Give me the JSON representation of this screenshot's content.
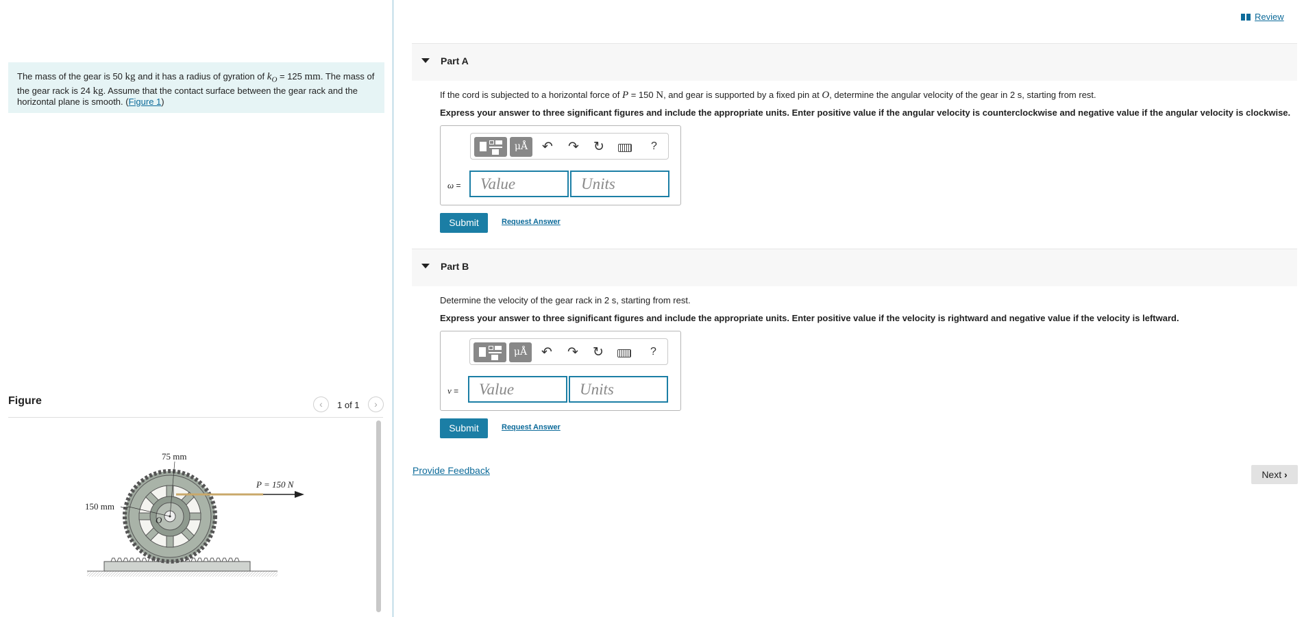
{
  "review": {
    "label": "Review"
  },
  "problem": {
    "t1": "The mass of the gear is 50 ",
    "kg1": "kg",
    "t2": " and it has a radius of gyration of ",
    "kO": "k",
    "kO_sub": "O",
    "t3": " = 125 ",
    "mm": "mm",
    "t4": ". The mass of the gear rack is 24 ",
    "kg2": "kg",
    "t5": ". Assume that the contact surface between the gear rack and the horizontal plane is smooth. (",
    "figure_link": "Figure 1",
    "t6": ")"
  },
  "figure": {
    "title": "Figure",
    "pager": "1 of 1",
    "labels": {
      "top": "75 mm",
      "left": "150 mm",
      "force": "P = 150 N",
      "center": "O"
    }
  },
  "partA": {
    "title": "Part A",
    "q_t1": "If the cord is subjected to a horizontal force of ",
    "q_P": "P",
    "q_t2": " = 150 ",
    "q_N": "N",
    "q_t3": ", and gear is supported by a fixed pin at ",
    "q_O": "O",
    "q_t4": ", determine the angular velocity of the gear in 2 s, starting from rest.",
    "instruction": "Express your answer to three significant figures and include the appropriate units. Enter positive value if the angular velocity is counterclockwise and negative value if the angular velocity is clockwise.",
    "var": "ω",
    "eq": " =",
    "value_placeholder": "Value",
    "units_placeholder": "Units",
    "submit": "Submit",
    "request": "Request Answer"
  },
  "partB": {
    "title": "Part B",
    "question": "Determine the velocity of the gear rack in 2 s, starting from rest.",
    "instruction": "Express your answer to three significant figures and include the appropriate units. Enter positive value if the velocity is rightward and negative value if the velocity is leftward.",
    "var": "v",
    "eq": " =",
    "value_placeholder": "Value",
    "units_placeholder": "Units",
    "submit": "Submit",
    "request": "Request Answer"
  },
  "toolbar": {
    "mu_label": "μÅ",
    "undo_icon": "↶",
    "redo_icon": "↷",
    "reset_icon": "↻",
    "help": "?"
  },
  "footer": {
    "feedback": "Provide Feedback",
    "next": "Next"
  }
}
